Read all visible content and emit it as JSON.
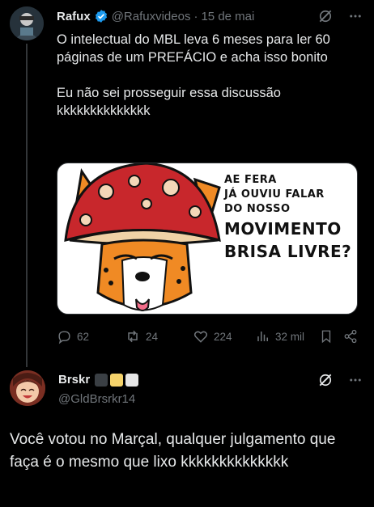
{
  "post": {
    "author_name": "Rafux",
    "author_handle": "@Rafuxvideos",
    "date_sep": "·",
    "date": "15 de mai",
    "paragraph1": "O intelectual do MBL leva 6 meses para ler 60 páginas de um PREFÁCIO e acha isso bonito",
    "paragraph2": "Eu não sei prosseguir essa discussão kkkkkkkkkkkkkk",
    "media_text": {
      "line1": "AE FERA",
      "line2": "JÁ OUVIU FALAR",
      "line3": "DO NOSSO",
      "line4": "MOVIMENTO",
      "line5": "BRISA LIVRE?"
    },
    "actions": {
      "replies": "62",
      "reposts": "24",
      "likes": "224",
      "views": "32 mil"
    },
    "icons": [
      "grok-icon",
      "more-icon",
      "verified-badge-icon",
      "reply-icon",
      "repost-icon",
      "like-icon",
      "views-icon",
      "bookmark-icon",
      "share-icon"
    ]
  },
  "reply": {
    "author_name": "Brskr",
    "author_handle": "@GldBrsrkr14",
    "text": "Você votou no Marçal, qualquer julgamento que faça é o mesmo que lixo kkkkkkkkkkkkkk",
    "chips": [
      "#3a3f44",
      "#f5d36b",
      "#e6e6e6"
    ]
  },
  "colors": {
    "background": "#000000",
    "text": "#e7e9ea",
    "secondary": "#71767b",
    "verified": "#1d9bf0"
  }
}
